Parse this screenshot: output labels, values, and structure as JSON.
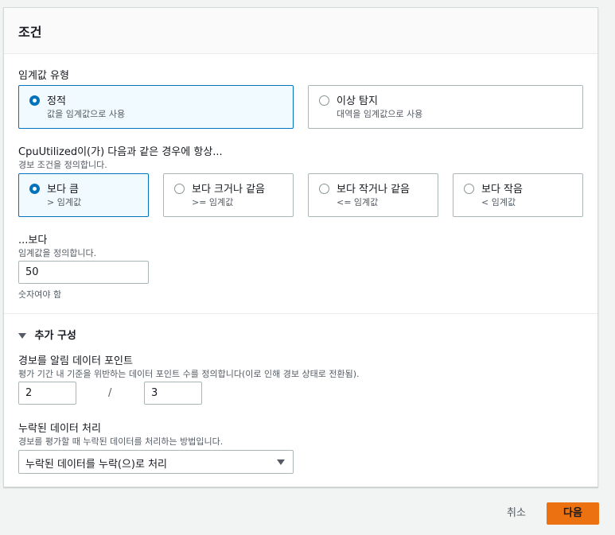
{
  "section": {
    "title": "조건"
  },
  "threshold_type": {
    "label": "임계값 유형",
    "options": [
      {
        "title": "정적",
        "desc": "값을 임계값으로 사용"
      },
      {
        "title": "이상 탐지",
        "desc": "대역을 임계값으로 사용"
      }
    ],
    "selected": "정적"
  },
  "condition": {
    "label": "CpuUtilized이(가) 다음과 같은 경우에 항상...",
    "desc": "경보 조건을 정의합니다.",
    "options": [
      {
        "title": "보다 큼",
        "desc": "> 임계값"
      },
      {
        "title": "보다 크거나 같음",
        "desc": ">= 임계값"
      },
      {
        "title": "보다 작거나 같음",
        "desc": "<= 임계값"
      },
      {
        "title": "보다 작음",
        "desc": "< 임계값"
      }
    ],
    "selected": "보다 큼"
  },
  "threshold": {
    "label": "...보다",
    "desc": "임계값을 정의합니다.",
    "value": "50",
    "hint": "숫자여야 함"
  },
  "additional": {
    "toggle_label": "추가 구성",
    "datapoints": {
      "label": "경보를 알림 데이터 포인트",
      "desc": "평가 기간 내 기준을 위반하는 데이터 포인트 수를 정의합니다(이로 인해 경보 상태로 전환됨).",
      "value1": "2",
      "separator": "/",
      "value2": "3"
    },
    "missing_data": {
      "label": "누락된 데이터 처리",
      "desc": "경보를 평가할 때 누락된 데이터를 처리하는 방법입니다.",
      "selected": "누락된 데이터를 누락(으)로 처리"
    }
  },
  "footer": {
    "cancel": "취소",
    "next": "다음"
  },
  "colors": {
    "accent": "#0073bb",
    "primary_button": "#ec7211"
  }
}
